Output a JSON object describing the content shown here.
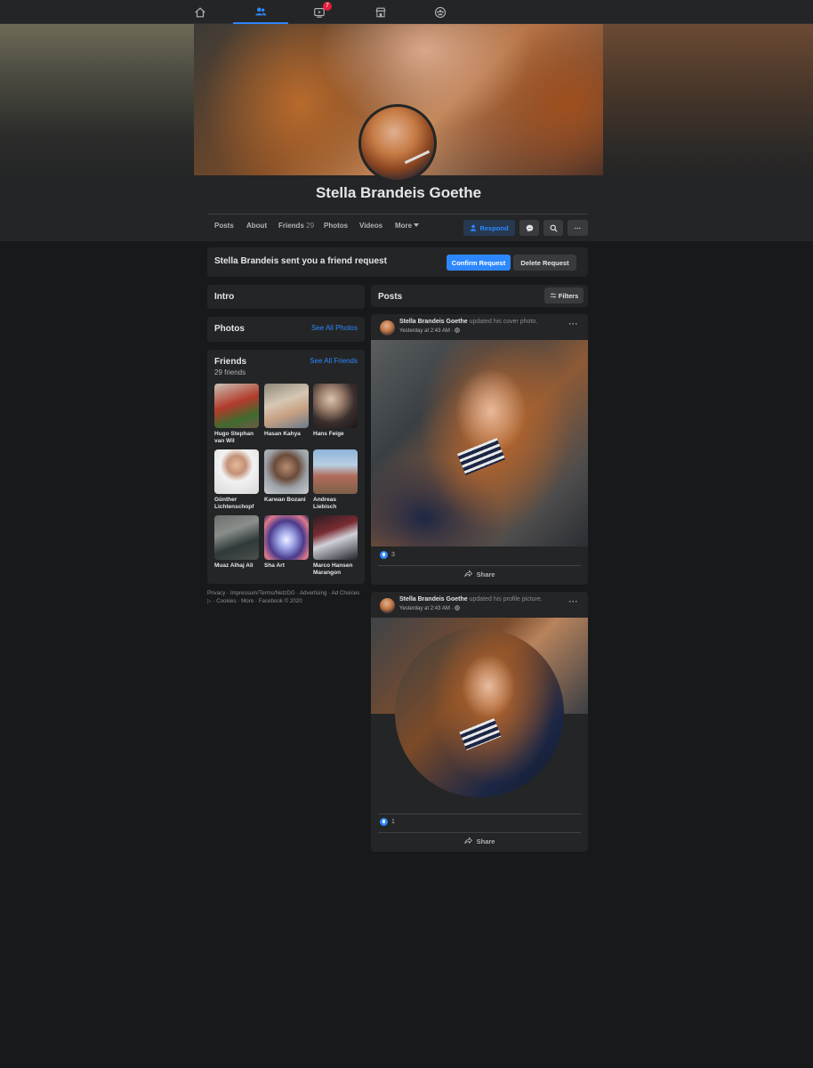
{
  "topnav": {
    "tabs": [
      {
        "name": "home",
        "icon": "home-icon"
      },
      {
        "name": "friends",
        "icon": "friends-icon",
        "active": true
      },
      {
        "name": "watch",
        "icon": "watch-icon",
        "badge": "7"
      },
      {
        "name": "marketplace",
        "icon": "marketplace-icon"
      },
      {
        "name": "groups",
        "icon": "groups-icon"
      }
    ]
  },
  "profile": {
    "name": "Stella Brandeis Goethe"
  },
  "profile_tabs": {
    "posts": "Posts",
    "about": "About",
    "friends": "Friends",
    "friends_count": "29",
    "photos": "Photos",
    "videos": "Videos",
    "more": "More",
    "respond": "Respond",
    "messenger_icon": "messenger-icon",
    "search_icon": "search-icon",
    "more_dots": "···"
  },
  "friend_request": {
    "text": "Stella Brandeis sent you a friend request",
    "confirm": "Confirm Request",
    "delete": "Delete Request"
  },
  "intro": {
    "title": "Intro"
  },
  "photos": {
    "title": "Photos",
    "see_all": "See All Photos"
  },
  "friends": {
    "title": "Friends",
    "count": "29 friends",
    "see_all": "See All Friends",
    "items": [
      {
        "name": "Hugo Stephan van Wil"
      },
      {
        "name": "Hasan Kahya"
      },
      {
        "name": "Hans Feige"
      },
      {
        "name": "Günther Lichtenschopf"
      },
      {
        "name": "Karwan Bozani"
      },
      {
        "name": "Andreas Liebisch"
      },
      {
        "name": "Muaz Alhaj Ali"
      },
      {
        "name": "Sha Art"
      },
      {
        "name": "Marco Hansen Marangon"
      }
    ]
  },
  "footer": {
    "line1": "Privacy · Impressum/Terms/NetzDG · Advertising · Ad Choices",
    "line2": "▷ · Cookies · More · Facebook © 2020"
  },
  "posts_section": {
    "title": "Posts",
    "filters": "Filters"
  },
  "posts": [
    {
      "author": "Stella Brandeis Goethe",
      "action": "updated his cover photo.",
      "time": "Yesterday at 2:43 AM · ",
      "reactions": "3",
      "share": "Share"
    },
    {
      "author": "Stella Brandeis Goethe",
      "action": "updated his profile picture.",
      "time": "Yesterday at 2:43 AM · ",
      "reactions": "1",
      "share": "Share"
    }
  ]
}
